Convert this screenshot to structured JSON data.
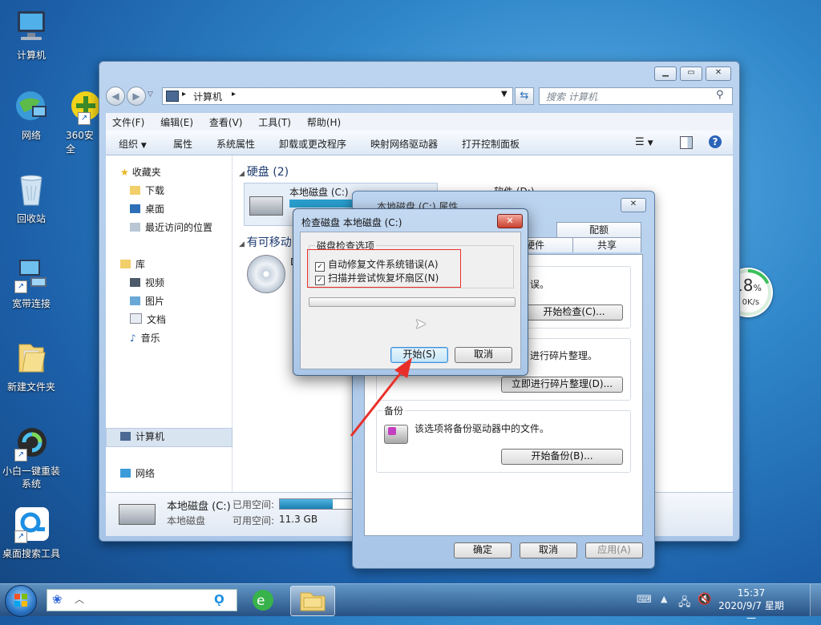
{
  "desktop": {
    "icons": [
      {
        "label": "计算机"
      },
      {
        "label": "网络"
      },
      {
        "label": "360安全"
      },
      {
        "label": "回收站"
      },
      {
        "label": "宽带连接"
      },
      {
        "label": "新建文件夹"
      },
      {
        "label": "小白一键重装\n系统"
      },
      {
        "label": "桌面搜索工具"
      }
    ]
  },
  "speed_widget": {
    "percent": "18",
    "unit": "%",
    "speed": "0K/s"
  },
  "explorer": {
    "address": {
      "path": "计算机"
    },
    "search": {
      "placeholder": "搜索 计算机"
    },
    "menu": [
      "文件(F)",
      "编辑(E)",
      "查看(V)",
      "工具(T)",
      "帮助(H)"
    ],
    "toolbar": {
      "organize": "组织",
      "items": [
        "属性",
        "系统属性",
        "卸载或更改程序",
        "映射网络驱动器",
        "打开控制面板"
      ]
    },
    "nav": {
      "favorites": "收藏夹",
      "favorites_items": [
        "下载",
        "桌面",
        "最近访问的位置"
      ],
      "libraries": "库",
      "library_items": [
        "视频",
        "图片",
        "文档",
        "音乐"
      ],
      "computer": "计算机",
      "network": "网络"
    },
    "content": {
      "hard_disks_header": "硬盘 (2)",
      "removable_header": "有可移动",
      "drive_c": "本地磁盘 (C:)",
      "drive_d": "软件 (D:)",
      "drive_label_cut": "D"
    },
    "details": {
      "name": "本地磁盘 (C:)",
      "type": "本地磁盘",
      "used_label": "已用空间:",
      "free_label": "可用空间:",
      "free_value": "11.3 GB",
      "used_fraction": 0.72
    }
  },
  "properties": {
    "title": "本地磁盘 (C:) 属性",
    "tabs_top": [
      "配额"
    ],
    "tabs_row2": [
      "硬件",
      "共享"
    ],
    "error_check_text": "误。",
    "error_check_button": "开始检查(C)...",
    "defrag_text": "进行碎片整理。",
    "defrag_button": "立即进行碎片整理(D)...",
    "backup_title": "备份",
    "backup_text": "该选项将备份驱动器中的文件。",
    "backup_button": "开始备份(B)...",
    "ok": "确定",
    "cancel": "取消",
    "apply": "应用(A)"
  },
  "check_disk": {
    "title": "检查磁盘 本地磁盘 (C:)",
    "group_title": "磁盘检查选项",
    "option1": "自动修复文件系统错误(A)",
    "option2": "扫描并尝试恢复坏扇区(N)",
    "start": "开始(S)",
    "cancel": "取消"
  },
  "taskbar": {
    "time": "15:37",
    "date": "2020/9/7 星期一"
  },
  "colors": {
    "annotation_red": "#e8302a",
    "accent": "#1a7fc4"
  }
}
